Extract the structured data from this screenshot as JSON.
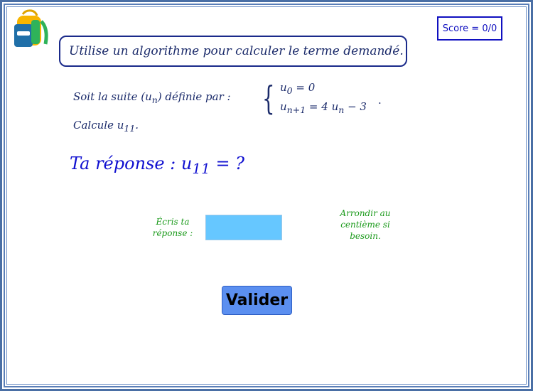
{
  "score": {
    "label": "Score = 0/0"
  },
  "instruction": {
    "text": "Utilise un algorithme pour calculer le terme demandé."
  },
  "problem": {
    "statement_prefix": "Soit la suite (u",
    "statement_sub": "n",
    "statement_suffix": ") définie par :",
    "line1_base": "u",
    "line1_sub": "0",
    "line1_rest": " = 0",
    "line2_base": "u",
    "line2_sub": "n+1",
    "line2_mid": " = 4 u",
    "line2_sub2": "n",
    "line2_rest": " − 3",
    "end_dot": ".",
    "calc_prefix": "Calcule  u",
    "calc_sub": "11",
    "calc_suffix": "."
  },
  "answer": {
    "prefix": "Ta réponse : u",
    "sub": "11",
    "suffix": " = ?"
  },
  "hints": {
    "left": "Écris ta réponse :",
    "right": "Arrondir au centième si besoin."
  },
  "input": {
    "value": "",
    "placeholder": ""
  },
  "validate_button": {
    "label": "Valider"
  },
  "colors": {
    "frame": "#4a6fa5",
    "score_border": "#1010c0",
    "input_bg": "#66c7ff",
    "button_bg": "#5b8ff0",
    "hint_green": "#1b9a1b",
    "answer_blue": "#1010d0"
  }
}
